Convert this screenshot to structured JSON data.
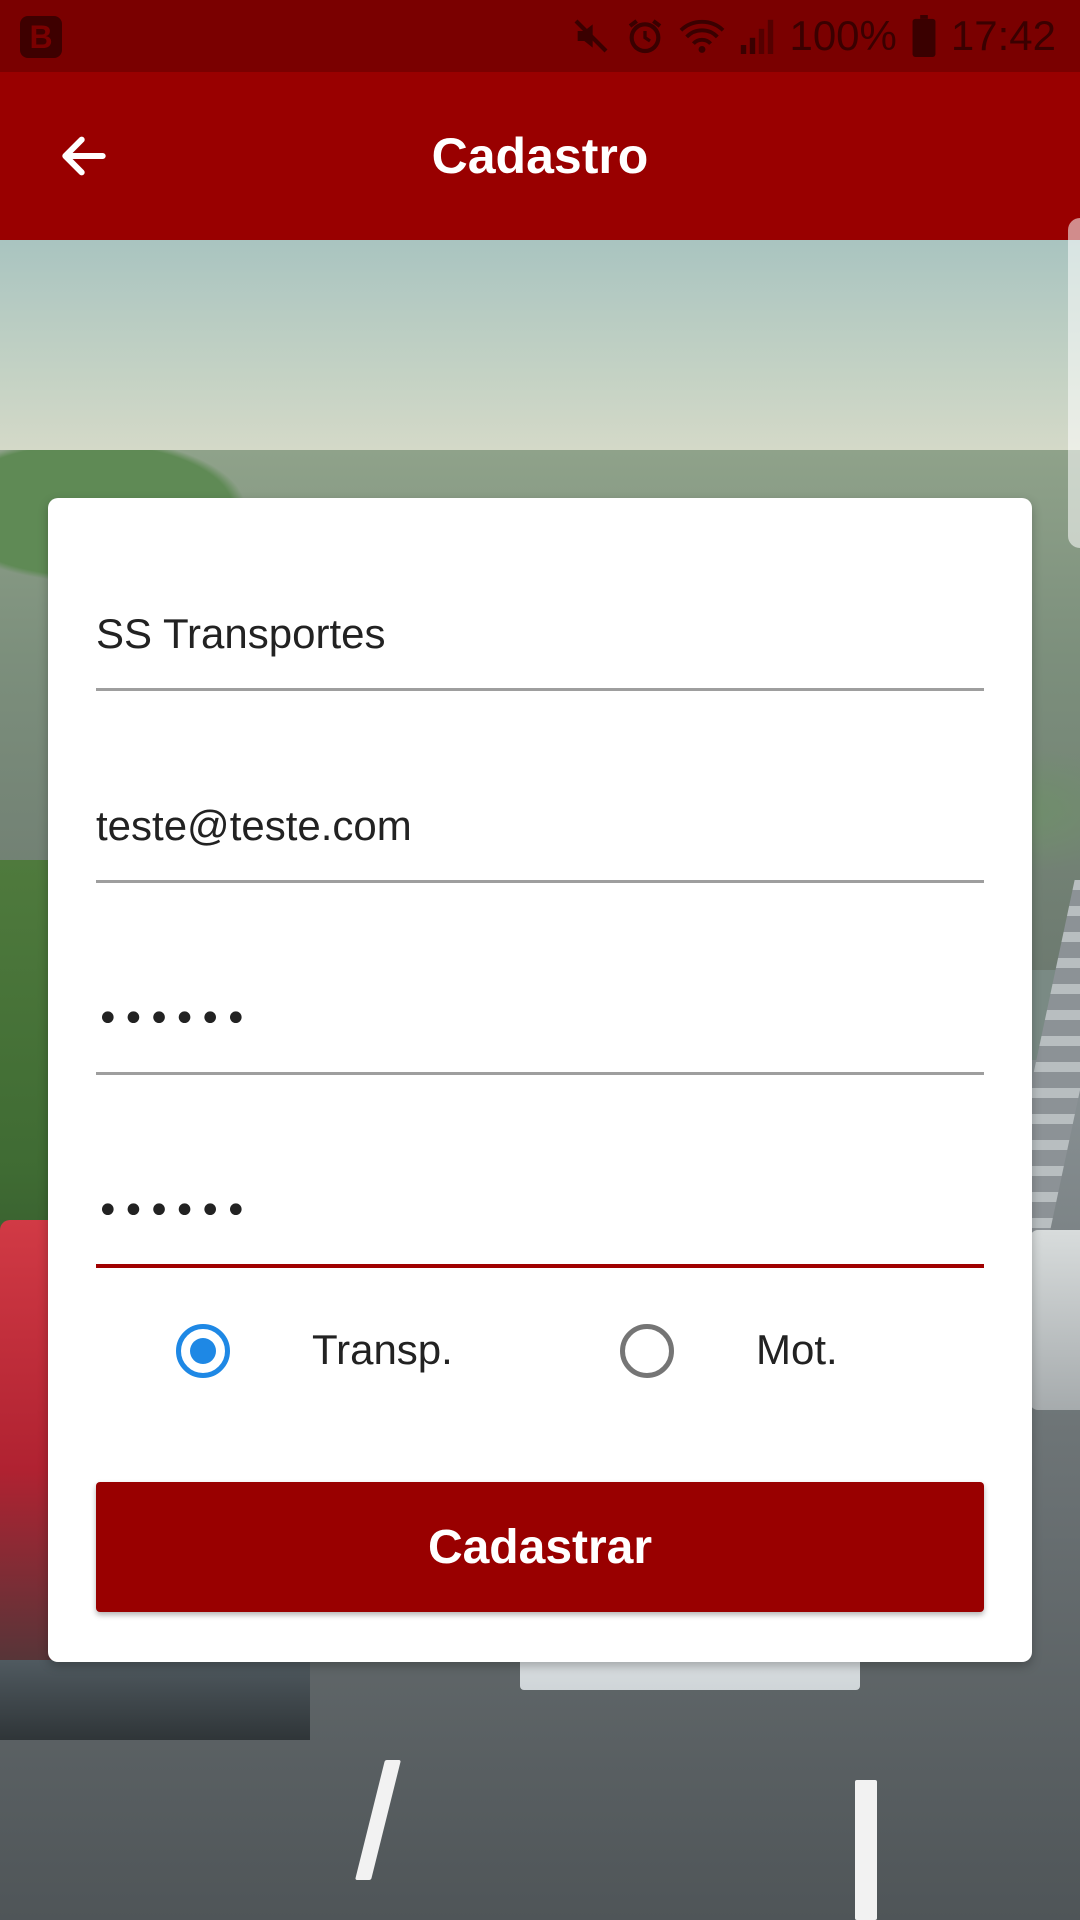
{
  "status_bar": {
    "app_badge": "B",
    "icons": [
      "mute-icon",
      "alarm-icon",
      "wifi-icon",
      "signal-icon",
      "battery-icon"
    ],
    "battery": "100%",
    "time": "17:42"
  },
  "toolbar": {
    "title": "Cadastro",
    "back_icon": "arrow-left-icon"
  },
  "form": {
    "name_value": "SS Transportes",
    "email_value": "teste@teste.com",
    "password_value": "••••••",
    "password_confirm_value": "••••••",
    "account_type": {
      "options": [
        {
          "label": "Transp.",
          "checked": true
        },
        {
          "label": "Mot.",
          "checked": false
        }
      ]
    },
    "submit_label": "Cadastrar"
  },
  "colors": {
    "primary": "#990000",
    "status_bar": "#7a0000",
    "radio_accent": "#1e88e5",
    "focused_underline": "#a00000"
  }
}
